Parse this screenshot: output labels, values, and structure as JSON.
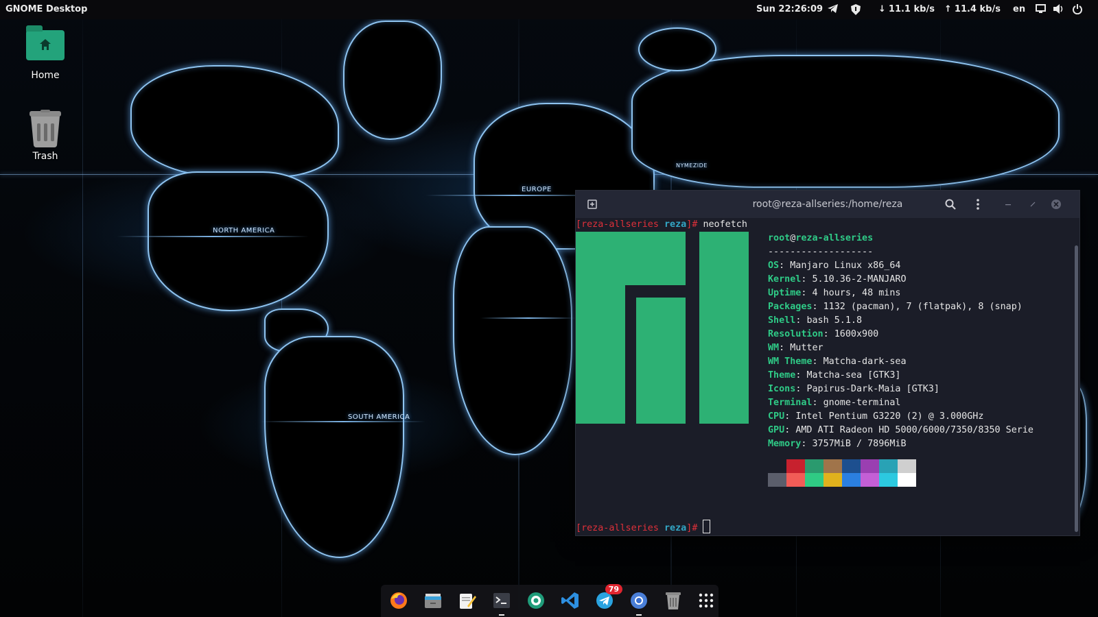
{
  "topbar": {
    "activities": "GNOME Desktop",
    "clock": "Sun 22:26:09",
    "net_down": "11.1 kb/s",
    "net_up": "11.4 kb/s",
    "keyboard_layout": "en"
  },
  "desktop": {
    "icons": [
      {
        "label": "Home",
        "icon": "home-folder-icon"
      },
      {
        "label": "Trash",
        "icon": "trash-icon"
      }
    ]
  },
  "wallpaper": {
    "labels": [
      "NORTH AMERICA",
      "EUROPE",
      "SOUTH AMERICA",
      "NYMEZIDE"
    ]
  },
  "terminal": {
    "title": "root@reza-allseries:/home/reza",
    "prompt": {
      "host": "reza-allseries",
      "dir": "reza",
      "symbol": "#"
    },
    "command": "neofetch",
    "user_at_host": {
      "user": "root",
      "at": "@",
      "host": "reza-allseries"
    },
    "separator": "-------------------",
    "info": [
      {
        "key": "OS",
        "value": "Manjaro Linux x86_64"
      },
      {
        "key": "Kernel",
        "value": "5.10.36-2-MANJARO"
      },
      {
        "key": "Uptime",
        "value": "4 hours, 48 mins"
      },
      {
        "key": "Packages",
        "value": "1132 (pacman), 7 (flatpak), 8 (snap)"
      },
      {
        "key": "Shell",
        "value": "bash 5.1.8"
      },
      {
        "key": "Resolution",
        "value": "1600x900"
      },
      {
        "key": "WM",
        "value": "Mutter"
      },
      {
        "key": "WM Theme",
        "value": "Matcha-dark-sea"
      },
      {
        "key": "Theme",
        "value": "Matcha-sea [GTK3]"
      },
      {
        "key": "Icons",
        "value": "Papirus-Dark-Maia [GTK3]"
      },
      {
        "key": "Terminal",
        "value": "gnome-terminal"
      },
      {
        "key": "CPU",
        "value": "Intel Pentium G3220 (2) @ 3.000GHz"
      },
      {
        "key": "GPU",
        "value": "AMD ATI Radeon HD 5000/6000/7350/8350 Serie"
      },
      {
        "key": "Memory",
        "value": "3757MiB / 7896MiB"
      }
    ],
    "palette_top": [
      "#1b1d28",
      "#c7212e",
      "#2a9a6e",
      "#a0744a",
      "#1d4f8f",
      "#9a3fb1",
      "#29a2b5",
      "#cfcfcf"
    ],
    "palette_bottom": [
      "#5b5e6b",
      "#f25c57",
      "#2fcb84",
      "#e0b21d",
      "#2b7fe0",
      "#c45fd6",
      "#2cc9e0",
      "#ffffff"
    ],
    "logo_color": "#2db174"
  },
  "dock": {
    "items": [
      {
        "name": "firefox-icon"
      },
      {
        "name": "files-icon"
      },
      {
        "name": "text-editor-icon"
      },
      {
        "name": "terminal-icon"
      },
      {
        "name": "camera-app-icon"
      },
      {
        "name": "vscode-icon"
      },
      {
        "name": "telegram-icon",
        "badge": "79"
      },
      {
        "name": "chromium-icon"
      },
      {
        "name": "trash-dock-icon"
      },
      {
        "name": "app-grid-icon"
      }
    ]
  },
  "colors": {
    "accent": "#2db174",
    "terminal_bg": "#1b1d28",
    "prompt_red": "#e0303a",
    "prompt_cyan": "#33a7c6"
  }
}
